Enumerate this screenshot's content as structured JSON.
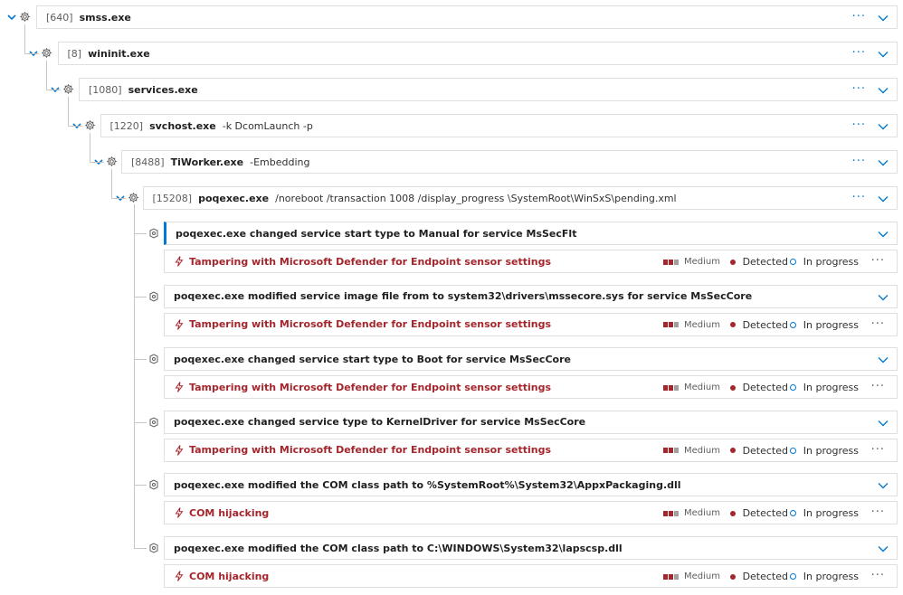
{
  "colors": {
    "accent": "#0078d4",
    "alert_red": "#a4262c",
    "severity_gray": "#a19f9d"
  },
  "processes": [
    {
      "pid": "[640]",
      "name": "smss.exe",
      "args": ""
    },
    {
      "pid": "[8]",
      "name": "wininit.exe",
      "args": ""
    },
    {
      "pid": "[1080]",
      "name": "services.exe",
      "args": ""
    },
    {
      "pid": "[1220]",
      "name": "svchost.exe",
      "args": "-k DcomLaunch -p"
    },
    {
      "pid": "[8488]",
      "name": "TiWorker.exe",
      "args": "-Embedding"
    },
    {
      "pid": "[15208]",
      "name": "poqexec.exe",
      "args": "/noreboot /transaction 1008 /display_progress \\SystemRoot\\WinSxS\\pending.xml"
    }
  ],
  "events": [
    {
      "text": "poqexec.exe changed service start type to Manual for service MsSecFlt",
      "alert": {
        "title": "Tampering with Microsoft Defender for Endpoint sensor settings",
        "severity": "Medium",
        "detection": "Detected",
        "status": "In progress"
      }
    },
    {
      "text": "poqexec.exe modified service image file from to system32\\drivers\\mssecore.sys for service MsSecCore",
      "alert": {
        "title": "Tampering with Microsoft Defender for Endpoint sensor settings",
        "severity": "Medium",
        "detection": "Detected",
        "status": "In progress"
      }
    },
    {
      "text": "poqexec.exe changed service start type to Boot for service MsSecCore",
      "alert": {
        "title": "Tampering with Microsoft Defender for Endpoint sensor settings",
        "severity": "Medium",
        "detection": "Detected",
        "status": "In progress"
      }
    },
    {
      "text": "poqexec.exe changed service type to KernelDriver for service MsSecCore",
      "alert": {
        "title": "Tampering with Microsoft Defender for Endpoint sensor settings",
        "severity": "Medium",
        "detection": "Detected",
        "status": "In progress"
      }
    },
    {
      "text": "poqexec.exe modified the COM class path to %SystemRoot%\\System32\\AppxPackaging.dll",
      "alert": {
        "title": "COM hijacking",
        "severity": "Medium",
        "detection": "Detected",
        "status": "In progress"
      }
    },
    {
      "text": "poqexec.exe modified the COM class path to C:\\WINDOWS\\System32\\lapscsp.dll",
      "alert": {
        "title": "COM hijacking",
        "severity": "Medium",
        "detection": "Detected",
        "status": "In progress"
      }
    }
  ],
  "icons": {
    "process": "gear-icon",
    "event": "registry-key-icon",
    "alert": "lightning-bolt-icon",
    "more": "more-options-icon",
    "expand": "chevron-down-icon",
    "collapse": "caret-down-icon"
  }
}
